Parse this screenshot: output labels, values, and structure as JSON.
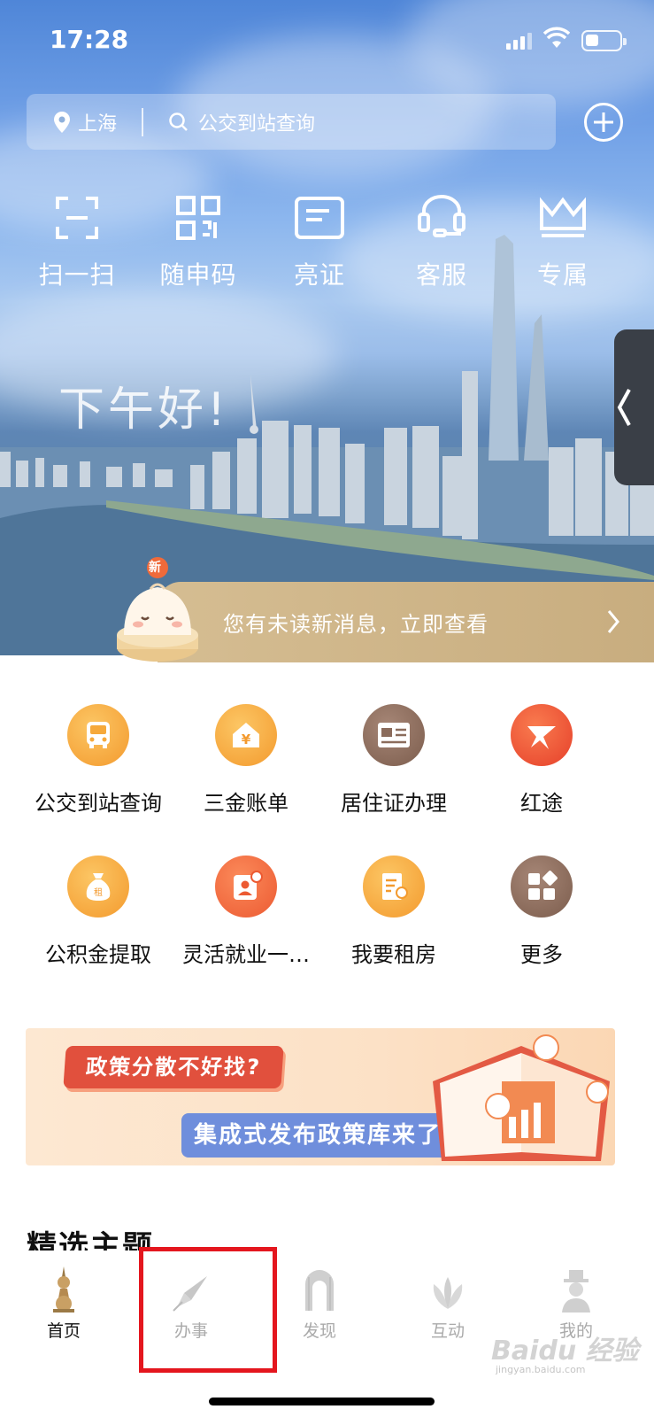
{
  "status_bar": {
    "time": "17:28"
  },
  "search_bar": {
    "location": "上海",
    "placeholder": "公交到站查询"
  },
  "quick_actions": [
    {
      "label": "扫一扫",
      "icon": "scan-icon"
    },
    {
      "label": "随申码",
      "icon": "qr-code-icon"
    },
    {
      "label": "亮证",
      "icon": "card-icon"
    },
    {
      "label": "客服",
      "icon": "headset-icon"
    },
    {
      "label": "专属",
      "icon": "crown-icon"
    }
  ],
  "greeting": "下午好!",
  "notice": {
    "badge": "新",
    "text": "您有未读新消息，立即查看"
  },
  "services": [
    {
      "label": "公交到站查询",
      "icon": "bus-icon",
      "color": "#f6a93b"
    },
    {
      "label": "三金账单",
      "icon": "yuan-house-icon",
      "color": "#f6a93b"
    },
    {
      "label": "居住证办理",
      "icon": "residence-card-icon",
      "color": "#8b6c5c"
    },
    {
      "label": "红途",
      "icon": "red-star-icon",
      "color": "#ee5433"
    },
    {
      "label": "公积金提取",
      "icon": "money-bag-icon",
      "color": "#f6a93b"
    },
    {
      "label": "灵活就业一…",
      "icon": "id-badge-icon",
      "color": "#ee6a3c"
    },
    {
      "label": "我要租房",
      "icon": "rent-house-icon",
      "color": "#f6a93b"
    },
    {
      "label": "更多",
      "icon": "grid-more-icon",
      "color": "#8b6c5c"
    }
  ],
  "banner": {
    "line1": "政策分散不好找?",
    "line2": "集成式发布政策库来了!"
  },
  "section_title": "精选主题",
  "tabs": [
    {
      "label": "首页",
      "icon": "home-tower-icon"
    },
    {
      "label": "办事",
      "icon": "pen-icon"
    },
    {
      "label": "发现",
      "icon": "arch-icon"
    },
    {
      "label": "互动",
      "icon": "magnolia-icon"
    },
    {
      "label": "我的",
      "icon": "person-hat-icon"
    }
  ],
  "watermark": {
    "text": "Baidu 经验",
    "url_text": "jingyan.baidu.com"
  }
}
